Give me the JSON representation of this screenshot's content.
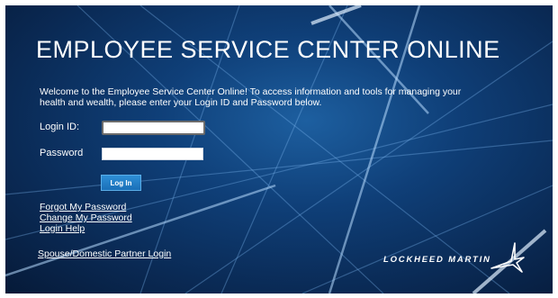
{
  "page": {
    "title": "EMPLOYEE SERVICE CENTER ONLINE",
    "intro": "Welcome to the Employee Service Center Online! To access information and tools for managing your health and wealth, please enter your Login ID and Password below."
  },
  "form": {
    "login_label": "Login ID:",
    "login_value": "",
    "password_label": "Password",
    "password_value": "",
    "submit_label": "Log In"
  },
  "links": {
    "forgot_password": "Forgot My Password",
    "change_password": "Change My Password",
    "login_help": "Login Help",
    "spouse_login": "Spouse/Domestic Partner Login"
  },
  "brand": {
    "logo_text": "LOCKHEED MARTIN",
    "background_color": "#0f3f78",
    "accent_color": "#1a6fb8"
  }
}
